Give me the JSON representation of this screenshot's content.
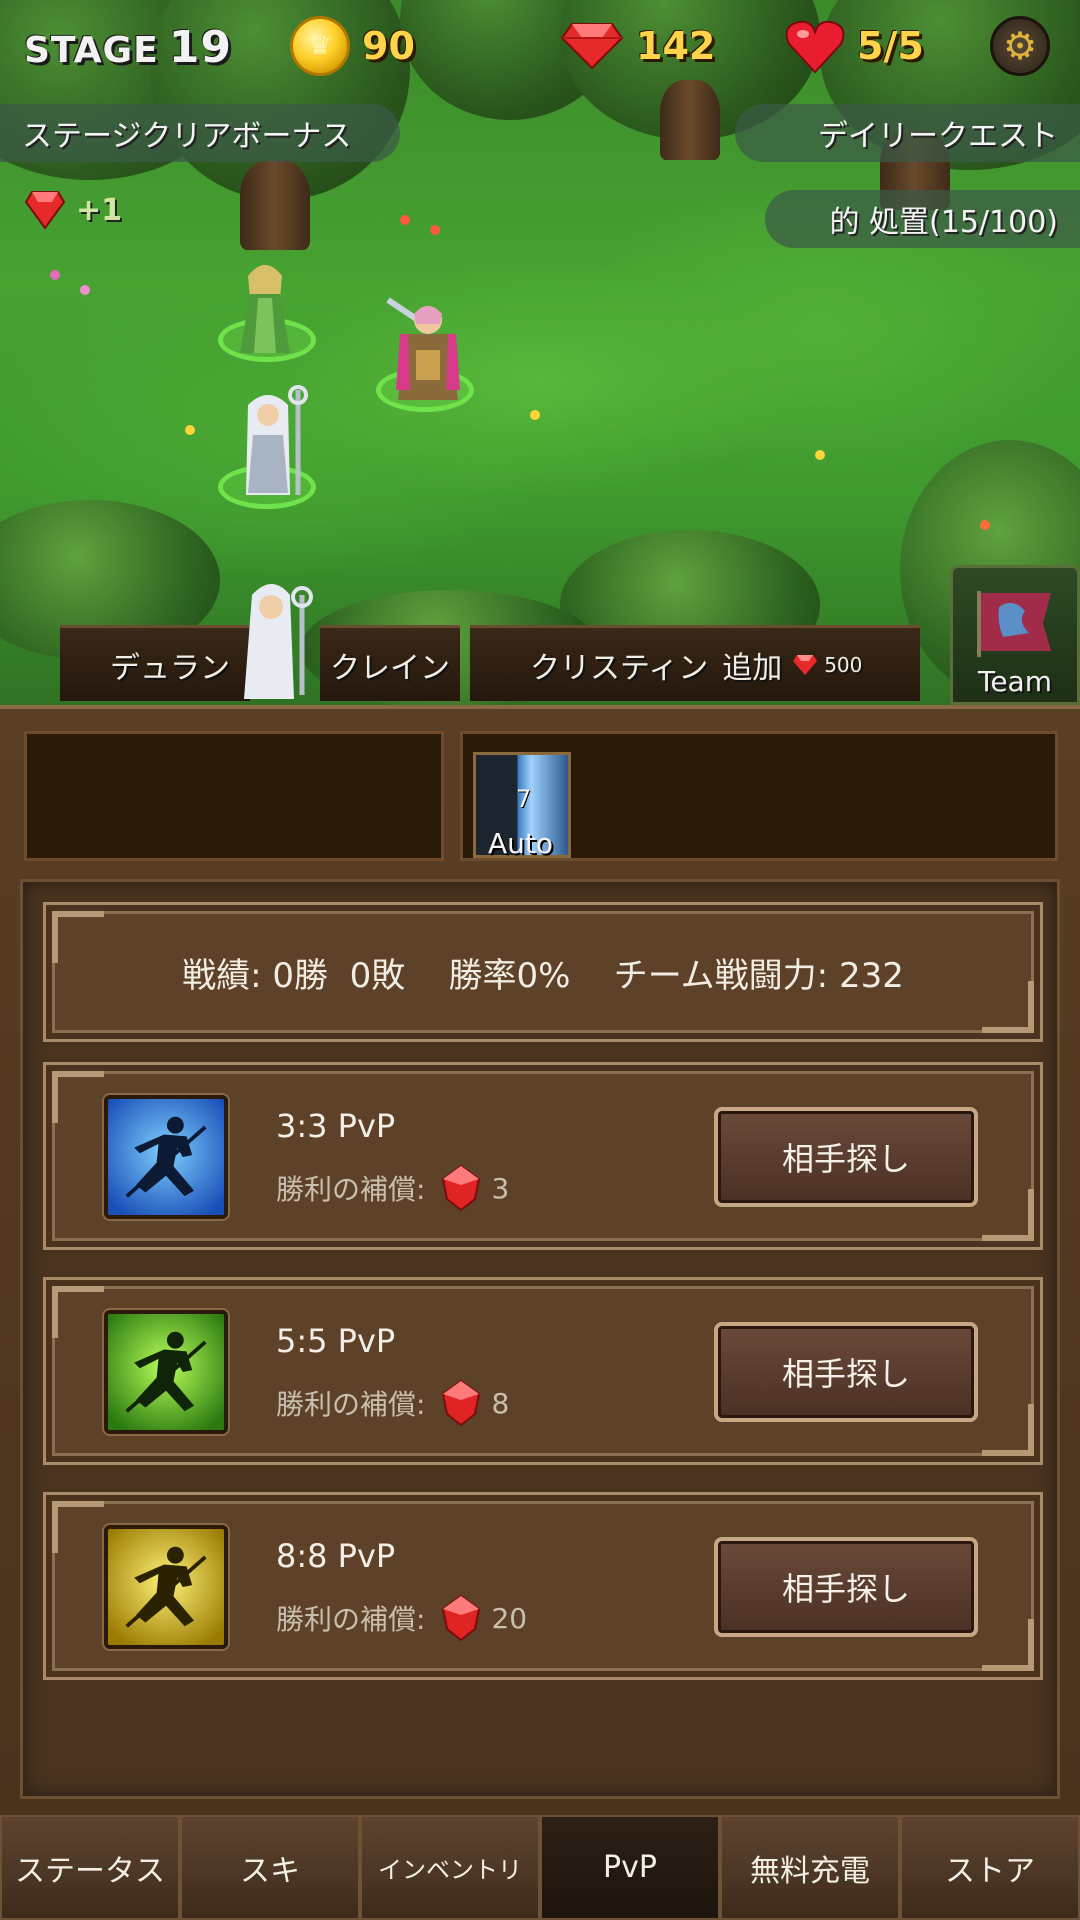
{
  "hud": {
    "stage_label": "STAGE",
    "stage_number": "19",
    "coins": "90",
    "gems": "142",
    "lives": "5/5",
    "icons": [
      "coin-icon",
      "gem-icon",
      "heart-icon",
      "gear-icon"
    ]
  },
  "banners": {
    "stage_clear_bonus": "ステージクリアボーナス",
    "bonus_gain": "+1",
    "daily_quest": "デイリークエスト",
    "daily_quest_progress": "的 処置(15/100)"
  },
  "party": {
    "members": [
      "デュラン",
      "クレイン",
      "クリスティン"
    ],
    "add_label": "追加",
    "add_cost": "500",
    "team_label": "Team"
  },
  "skill": {
    "count": "7",
    "auto_label": "Auto"
  },
  "pvp": {
    "stats": "戦績: 0勝  0敗    勝率0%    チーム戦闘力: 232",
    "reward_label": "勝利の補償:",
    "find_label": "相手探し",
    "modes": [
      {
        "title": "3:3 PvP",
        "reward": "3",
        "color": "#2f7cf0"
      },
      {
        "title": "5:5 PvP",
        "reward": "8",
        "color": "#5fc81e"
      },
      {
        "title": "8:8 PvP",
        "reward": "20",
        "color": "#e0c21a"
      }
    ]
  },
  "tabs": [
    "ステータス",
    "スキ",
    "インベントリ",
    "PvP",
    "無料充電",
    "ストア"
  ],
  "active_tab": "PvP"
}
